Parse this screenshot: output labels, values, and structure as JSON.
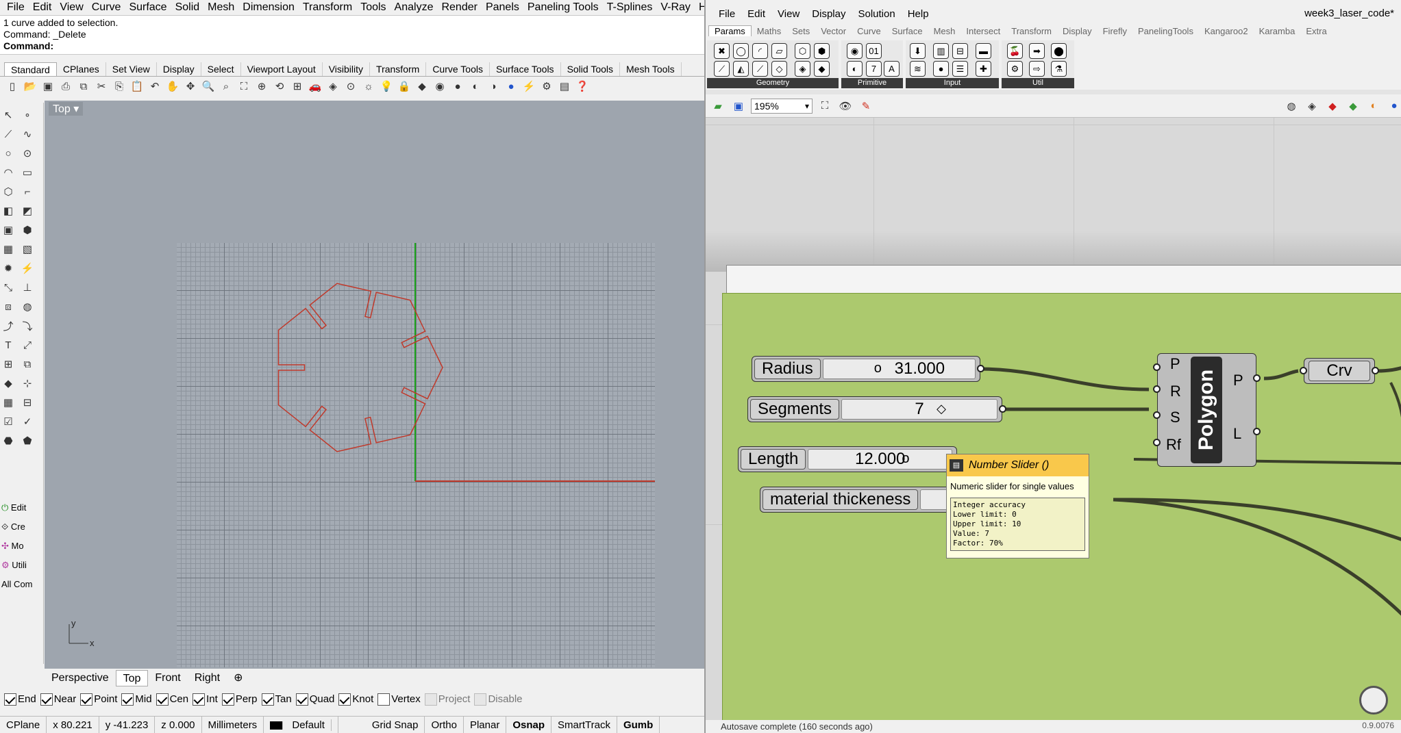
{
  "rhino": {
    "menu": [
      "File",
      "Edit",
      "View",
      "Curve",
      "Surface",
      "Solid",
      "Mesh",
      "Dimension",
      "Transform",
      "Tools",
      "Analyze",
      "Render",
      "Panels",
      "Paneling Tools",
      "T-Splines",
      "V-Ray",
      "Help"
    ],
    "command_history": [
      "1 curve added to selection.",
      "Command: _Delete"
    ],
    "command_prompt": "Command:",
    "toolbar_tabs": [
      "Standard",
      "CPlanes",
      "Set View",
      "Display",
      "Select",
      "Viewport Layout",
      "Visibility",
      "Transform",
      "Curve Tools",
      "Surface Tools",
      "Solid Tools",
      "Mesh Tools"
    ],
    "active_toolbar_tab": "Standard",
    "left_labels": [
      "Edit",
      "Cre",
      "Mo",
      "Utili",
      "All Com"
    ],
    "viewport_title": "Top",
    "axis_y": "y",
    "axis_x": "x",
    "viewport_tabs": [
      "Perspective",
      "Top",
      "Front",
      "Right"
    ],
    "osnap": [
      {
        "label": "End",
        "checked": true
      },
      {
        "label": "Near",
        "checked": true
      },
      {
        "label": "Point",
        "checked": true
      },
      {
        "label": "Mid",
        "checked": true
      },
      {
        "label": "Cen",
        "checked": true
      },
      {
        "label": "Int",
        "checked": true
      },
      {
        "label": "Perp",
        "checked": true
      },
      {
        "label": "Tan",
        "checked": true
      },
      {
        "label": "Quad",
        "checked": true
      },
      {
        "label": "Knot",
        "checked": true
      },
      {
        "label": "Vertex",
        "checked": false
      },
      {
        "label": "Project",
        "checked": false,
        "disabled": true
      },
      {
        "label": "Disable",
        "checked": false,
        "disabled": true
      }
    ],
    "status": {
      "cplane": "CPlane",
      "x": "x 80.221",
      "y": "y -41.223",
      "z": "z 0.000",
      "units": "Millimeters",
      "layer": "Default",
      "grid_snap": "Grid Snap",
      "ortho": "Ortho",
      "planar": "Planar",
      "osnap": "Osnap",
      "smarttrack": "SmartTrack",
      "gumball": "Gumb"
    },
    "curve_color": "#c0392b"
  },
  "grasshopper": {
    "menu": [
      "File",
      "Edit",
      "View",
      "Display",
      "Solution",
      "Help"
    ],
    "doc_title": "week3_laser_code*",
    "tabs": [
      "Params",
      "Maths",
      "Sets",
      "Vector",
      "Curve",
      "Surface",
      "Mesh",
      "Intersect",
      "Transform",
      "Display",
      "Firefly",
      "PanelingTools",
      "Kangaroo2",
      "Karamba",
      "Extra"
    ],
    "active_tab": "Params",
    "groups": [
      "Geometry",
      "Primitive",
      "Input",
      "Util"
    ],
    "zoom": "195%",
    "sliders": [
      {
        "name": "Radius",
        "value": "31.000"
      },
      {
        "name": "Segments",
        "value": "7"
      },
      {
        "name": "Length",
        "value": "12.000"
      },
      {
        "name": "material thickeness",
        "value": ""
      }
    ],
    "polygon": {
      "name": "Polygon",
      "inputs": [
        "P",
        "R",
        "S",
        "Rf"
      ],
      "outputs": [
        "P",
        "L"
      ]
    },
    "crv": "Crv",
    "tooltip": {
      "title": "Number Slider ()",
      "desc": "Numeric slider for single values",
      "details": "Integer accuracy\nLower limit: 0\nUpper limit: 10\nValue: 7\nFactor: 70%"
    },
    "group_color": "#acc96e",
    "status": "Autosave complete (160 seconds ago)",
    "version": "0.9.0076"
  }
}
